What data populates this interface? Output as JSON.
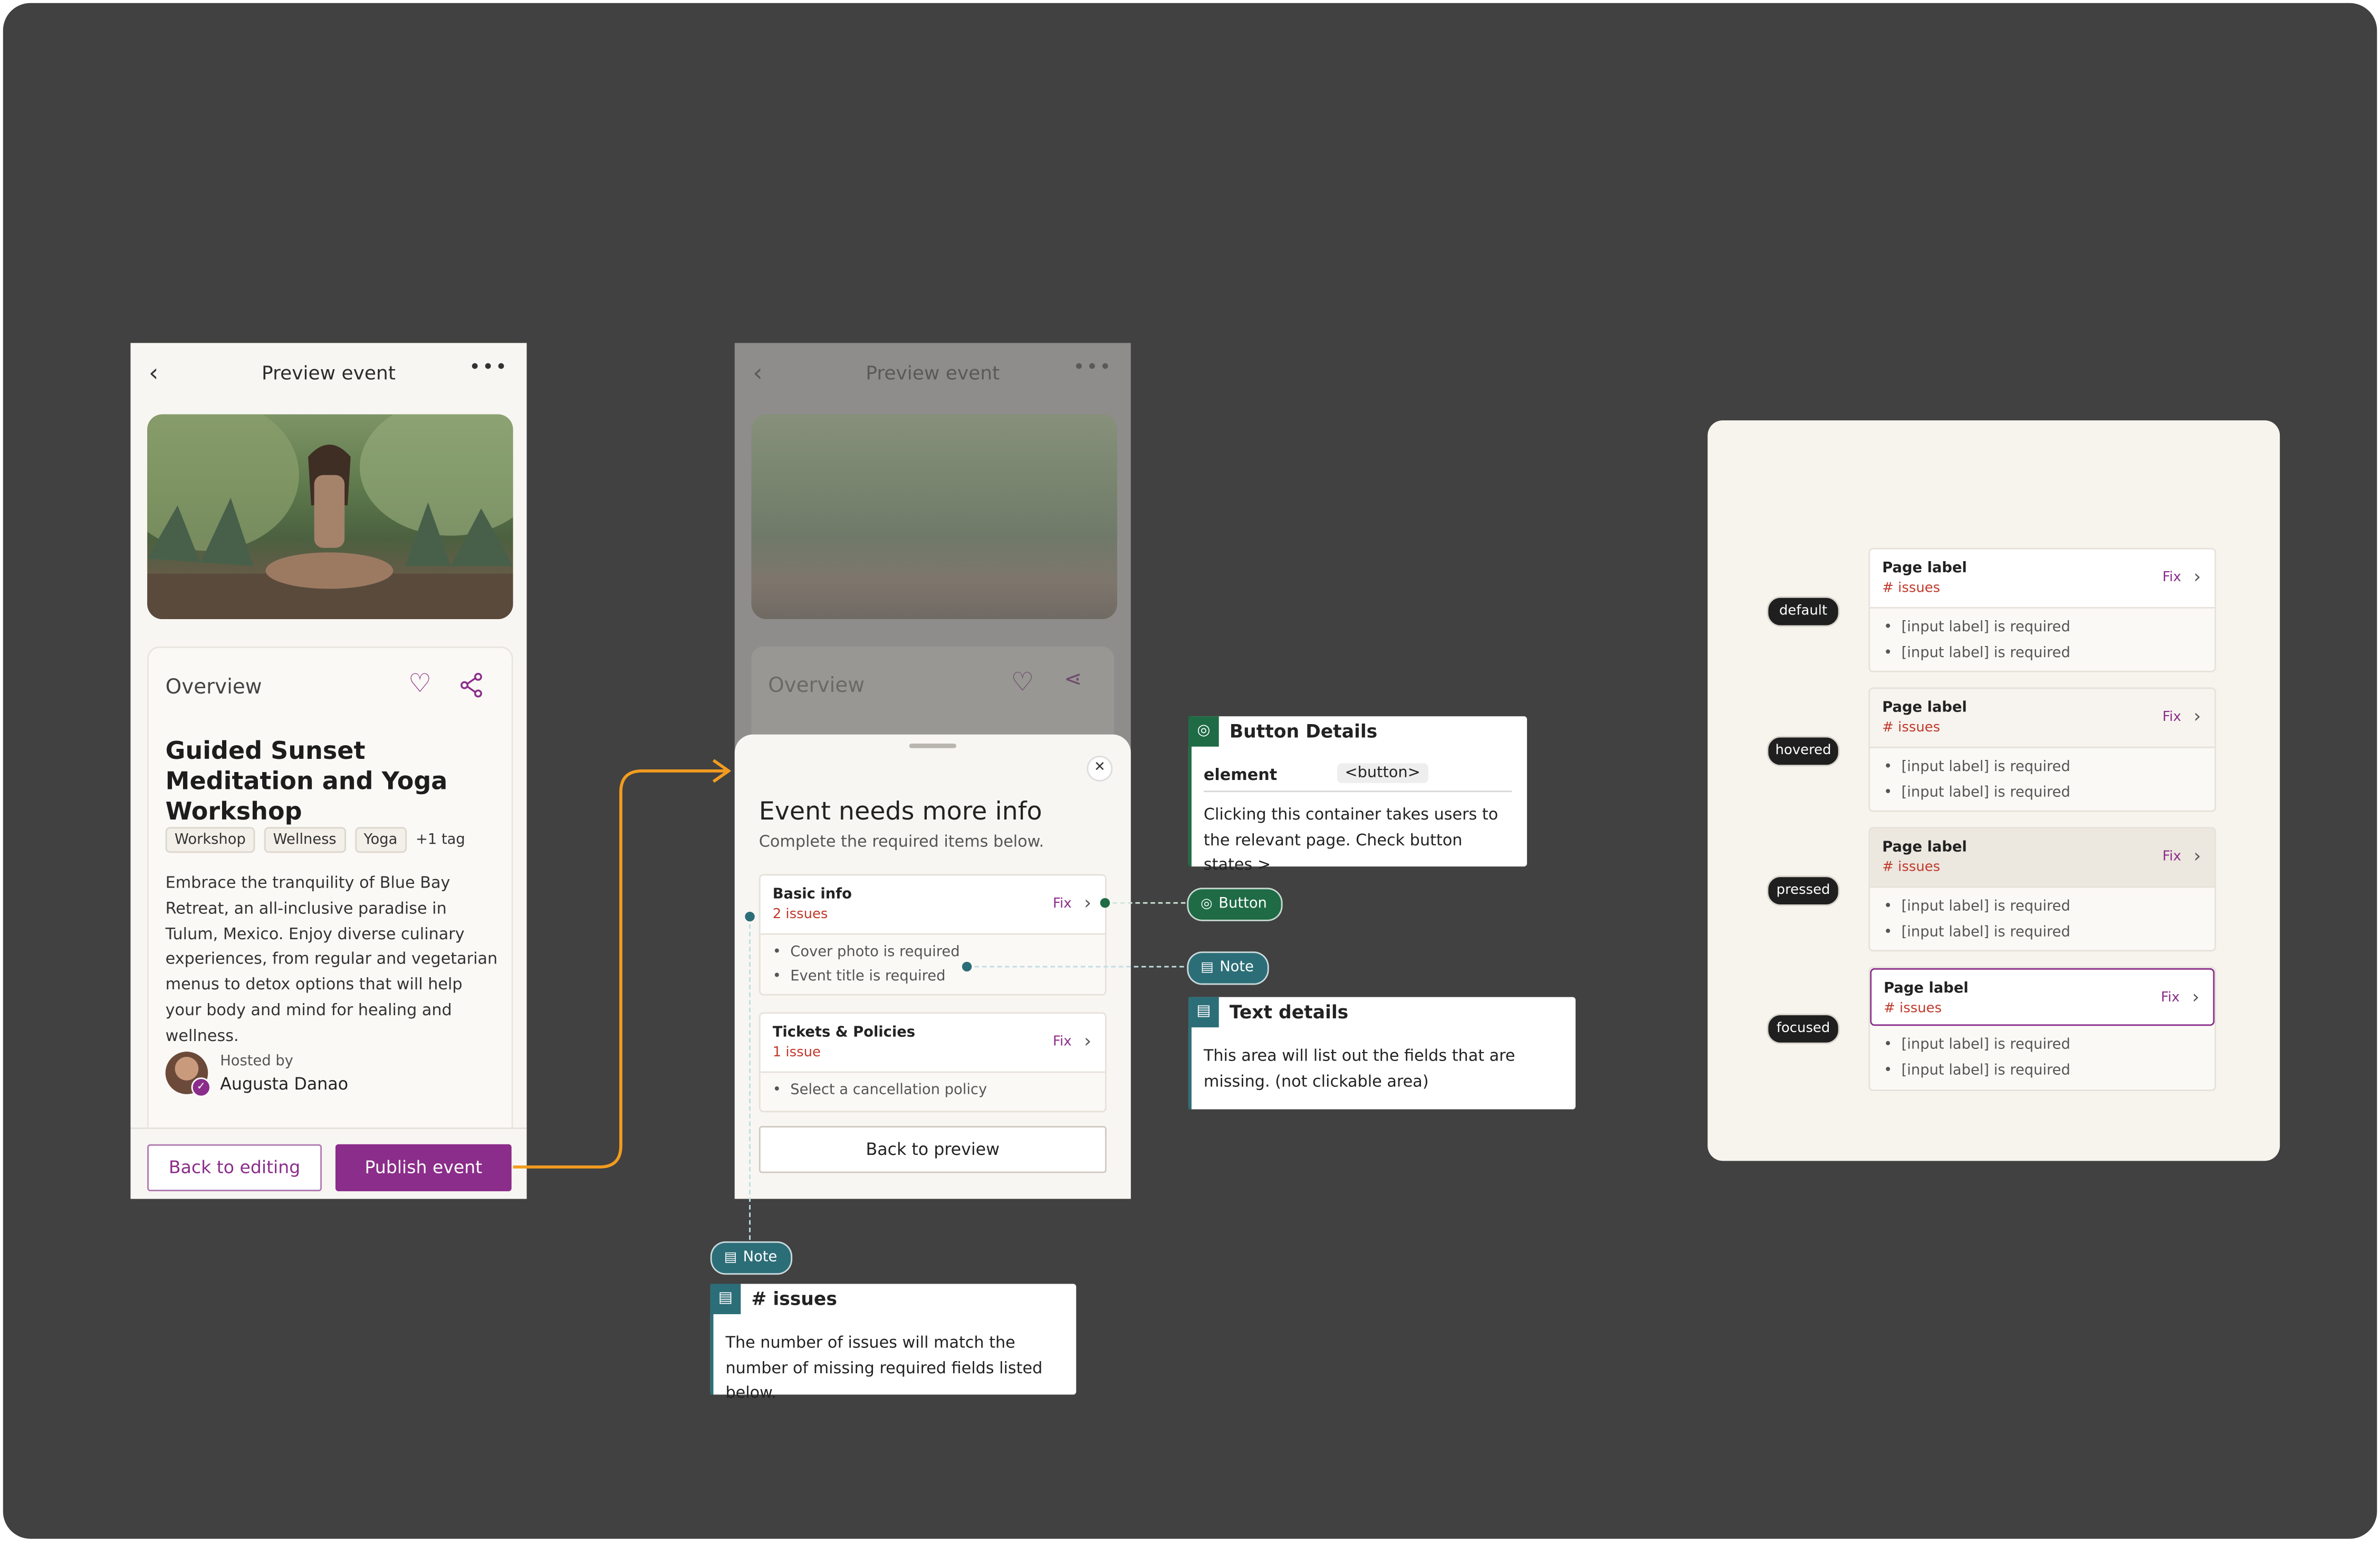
{
  "screen1": {
    "title": "Preview event",
    "overview_label": "Overview",
    "event_title": "Guided Sunset Meditation and Yoga Workshop",
    "tags": [
      "Workshop",
      "Wellness",
      "Yoga",
      "+1 tag"
    ],
    "description": "Embrace the tranquility of Blue Bay Retreat, an all-inclusive paradise in Tulum, Mexico. Enjoy diverse culinary experiences, from regular and vegetarian menus to detox options that will help your body and mind for healing and wellness.",
    "hosted_by_label": "Hosted by",
    "host_name": "Augusta Danao",
    "back_button": "Back to editing",
    "publish_button": "Publish event"
  },
  "screen2": {
    "title": "Preview event",
    "overview_label": "Overview",
    "sheet_title": "Event needs more info",
    "sheet_subtitle": "Complete the required items below.",
    "sections": [
      {
        "title": "Basic info",
        "issues": "2 issues",
        "fix": "Fix",
        "items": [
          "Cover photo is required",
          "Event title is required"
        ]
      },
      {
        "title": "Tickets & Policies",
        "issues": "1 issue",
        "fix": "Fix",
        "items": [
          "Select a cancellation policy"
        ]
      }
    ],
    "back_to_preview": "Back to preview"
  },
  "annotations": {
    "button_details": {
      "title": "Button Details",
      "element_label": "element",
      "element_value": "<button>",
      "text": "Clicking this container takes users to the relevant page. Check button states >"
    },
    "button_pill": "Button",
    "note_pill": "Note",
    "text_details": {
      "title": "Text details",
      "text": "This area will list out the fields that are missing. (not clickable area)"
    },
    "issues_note": {
      "title": "# issues",
      "text": "The number of issues will match the number of missing required fields listed below."
    },
    "issues_pill": "Note"
  },
  "states": [
    {
      "state": "default",
      "label": "Page label",
      "issues": "# issues",
      "fix": "Fix",
      "items": [
        "[input label] is required",
        "[input label] is required"
      ]
    },
    {
      "state": "hovered",
      "label": "Page label",
      "issues": "# issues",
      "fix": "Fix",
      "items": [
        "[input label] is required",
        "[input label] is required"
      ]
    },
    {
      "state": "pressed",
      "label": "Page label",
      "issues": "# issues",
      "fix": "Fix",
      "items": [
        "[input label] is required",
        "[input label] is required"
      ]
    },
    {
      "state": "focused",
      "label": "Page label",
      "issues": "# issues",
      "fix": "Fix",
      "items": [
        "[input label] is required",
        "[input label] is required"
      ]
    }
  ],
  "colors": {
    "accent": "#8b2d8a",
    "issue_red": "#c0392b",
    "arrow_orange": "#f39c1f",
    "note_teal": "#2c6e78",
    "button_green": "#1e6b45",
    "canvas": "#414141"
  }
}
